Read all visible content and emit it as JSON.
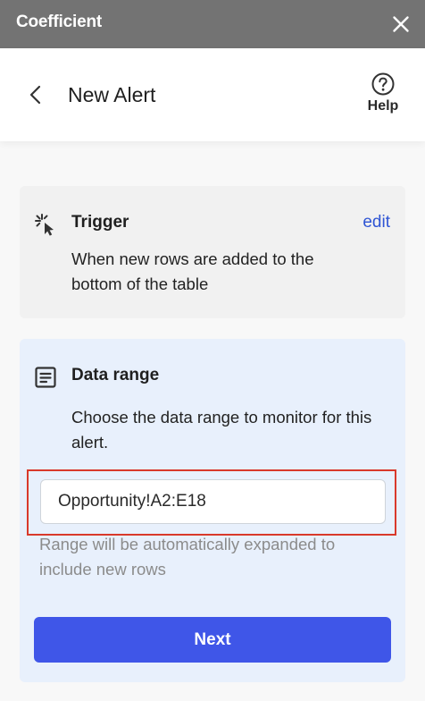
{
  "window": {
    "app_title": "Coefficient",
    "close_icon": "close-icon"
  },
  "header": {
    "title": "New Alert",
    "back_icon": "chevron-left-icon",
    "help_icon": "help-circle-icon",
    "help_label": "Help"
  },
  "trigger": {
    "icon": "click-sparkle-icon",
    "title": "Trigger",
    "edit_label": "edit",
    "description": "When new rows are added to the bottom of the table"
  },
  "data_range": {
    "icon": "list-box-icon",
    "title": "Data range",
    "description": "Choose the data range to monitor for this alert.",
    "range_value": "Opportunity!A2:E18",
    "hint": "Range will be automatically expanded to include new rows",
    "highlight_color": "#d9392b"
  },
  "actions": {
    "next_label": "Next"
  },
  "colors": {
    "titlebar": "#737373",
    "accent": "#3f56e8",
    "link": "#2f55d4",
    "range_card_bg": "#e8f0fc",
    "trigger_card_bg": "#f1f1f1"
  }
}
